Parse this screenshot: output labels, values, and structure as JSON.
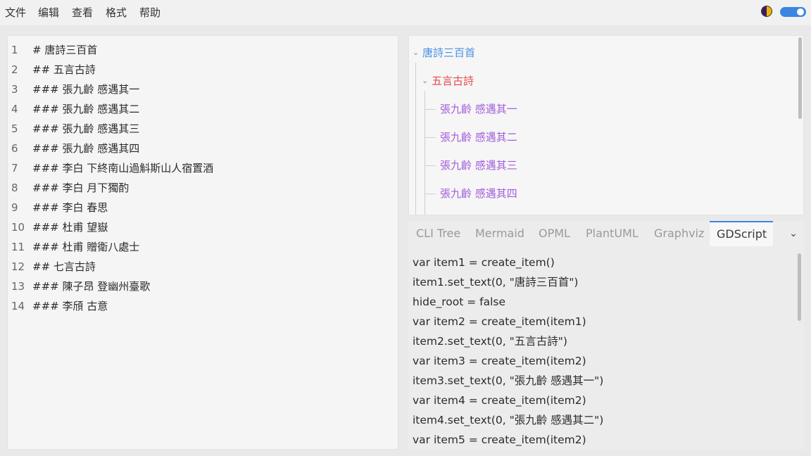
{
  "menu": [
    "文件",
    "编辑",
    "查看",
    "格式",
    "帮助"
  ],
  "editor": {
    "lines": [
      {
        "no": "1",
        "text": "# 唐詩三百首"
      },
      {
        "no": "2",
        "text": "## 五言古詩"
      },
      {
        "no": "3",
        "text": "### 張九齡 感遇其一"
      },
      {
        "no": "4",
        "text": "### 張九齡 感遇其二"
      },
      {
        "no": "5",
        "text": "### 張九齡 感遇其三"
      },
      {
        "no": "6",
        "text": "### 張九齡 感遇其四"
      },
      {
        "no": "7",
        "text": "### 李白 下終南山過斛斯山人宿置酒"
      },
      {
        "no": "8",
        "text": "### 李白 月下獨酌"
      },
      {
        "no": "9",
        "text": "### 李白 春思"
      },
      {
        "no": "10",
        "text": "### 杜甫 望嶽"
      },
      {
        "no": "11",
        "text": "### 杜甫 贈衛八處士"
      },
      {
        "no": "12",
        "text": "## 七言古詩"
      },
      {
        "no": "13",
        "text": "### 陳子昂 登幽州臺歌"
      },
      {
        "no": "14",
        "text": "### 李頎 古意"
      }
    ]
  },
  "tree": {
    "root": "唐詩三百首",
    "level1": "五言古詩",
    "leaves": [
      "張九齡 感遇其一",
      "張九齡 感遇其二",
      "張九齡 感遇其三",
      "張九齡 感遇其四"
    ],
    "colors": {
      "root": "#4a90e2",
      "level1": "#e5484d",
      "leaf": "#a25ddc"
    }
  },
  "tabs": {
    "items": [
      "CLI Tree",
      "Mermaid",
      "OPML",
      "PlantUML",
      "Graphviz",
      "GDScript"
    ],
    "active_index": 5,
    "accent": "#3a86e0"
  },
  "code": [
    "var item1 = create_item()",
    "item1.set_text(0, \"唐詩三百首\")",
    "hide_root = false",
    "var item2 = create_item(item1)",
    "item2.set_text(0, \"五言古詩\")",
    "var item3 = create_item(item2)",
    "item3.set_text(0, \"張九齡 感遇其一\")",
    "var item4 = create_item(item2)",
    "item4.set_text(0, \"張九齡 感遇其二\")",
    "var item5 = create_item(item2)"
  ]
}
